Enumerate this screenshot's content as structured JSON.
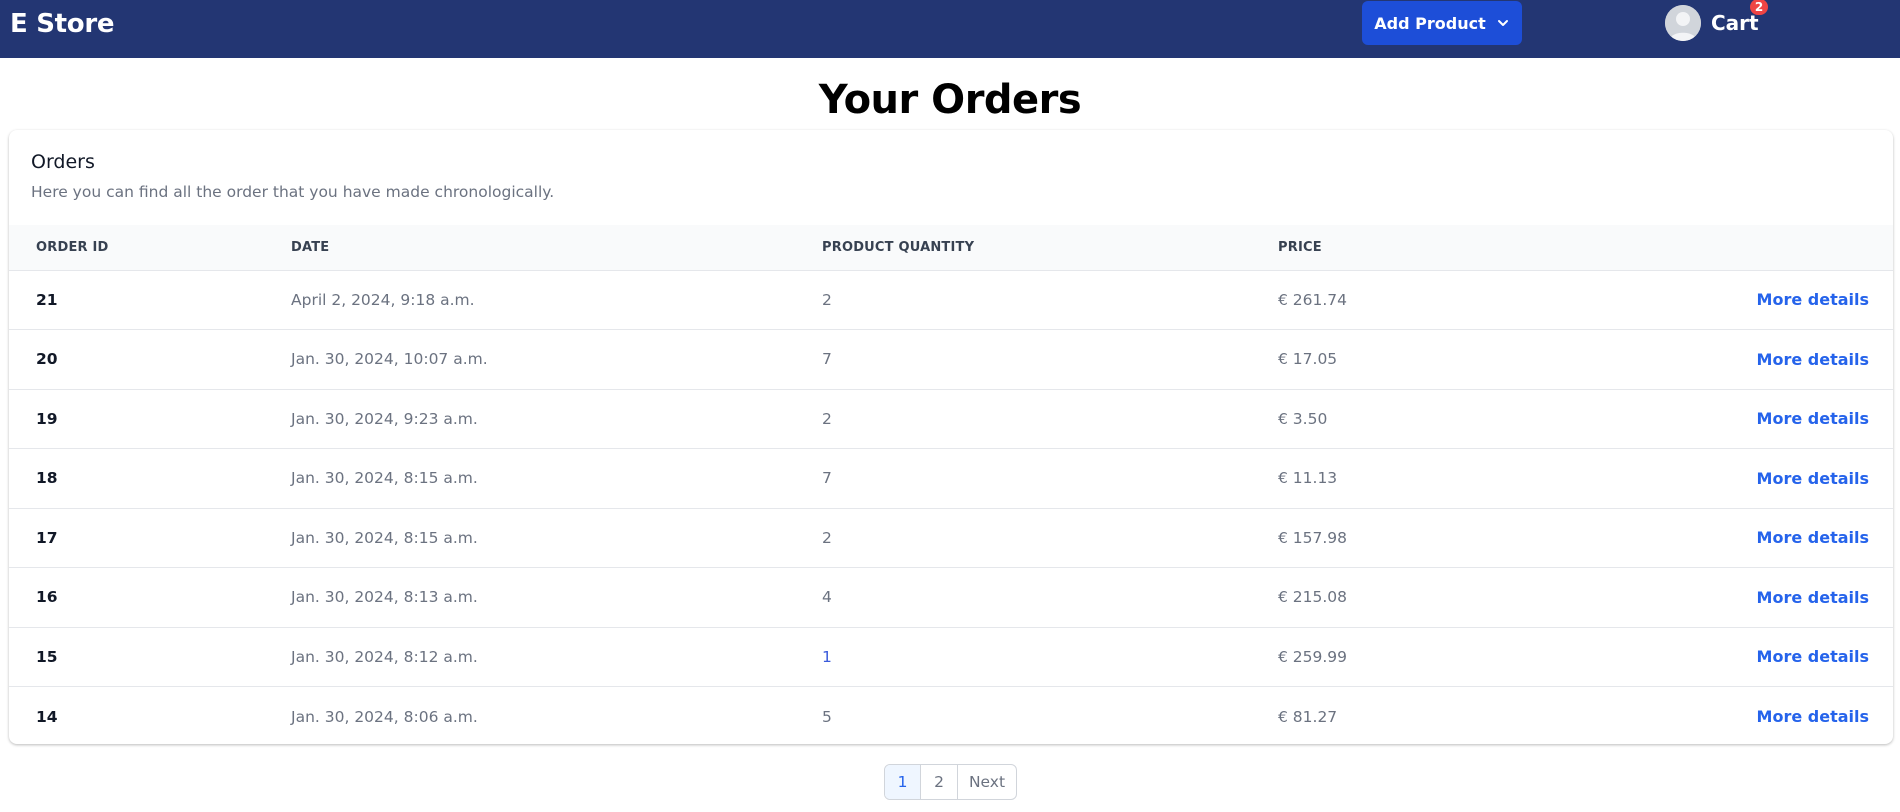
{
  "navbar": {
    "brand": "E Store",
    "add_product_label": "Add Product",
    "cart_label": "Cart",
    "cart_count": "2",
    "colors": {
      "background": "#233673",
      "button": "#1d4ed8",
      "badge": "#ef4444"
    }
  },
  "page": {
    "title": "Your Orders"
  },
  "orders_card": {
    "title": "Orders",
    "description": "Here you can find all the order that you have made chronologically.",
    "columns": [
      "ORDER ID",
      "DATE",
      "PRODUCT QUANTITY",
      "PRICE"
    ],
    "rows": [
      {
        "id": "21",
        "date": "April 2, 2024, 9:18 a.m.",
        "quantity": "2",
        "price": "€ 261.74",
        "action": "More details"
      },
      {
        "id": "20",
        "date": "Jan. 30, 2024, 10:07 a.m.",
        "quantity": "7",
        "price": "€ 17.05",
        "action": "More details"
      },
      {
        "id": "19",
        "date": "Jan. 30, 2024, 9:23 a.m.",
        "quantity": "2",
        "price": "€ 3.50",
        "action": "More details"
      },
      {
        "id": "18",
        "date": "Jan. 30, 2024, 8:15 a.m.",
        "quantity": "7",
        "price": "€ 11.13",
        "action": "More details"
      },
      {
        "id": "17",
        "date": "Jan. 30, 2024, 8:15 a.m.",
        "quantity": "2",
        "price": "€ 157.98",
        "action": "More details"
      },
      {
        "id": "16",
        "date": "Jan. 30, 2024, 8:13 a.m.",
        "quantity": "4",
        "price": "€ 215.08",
        "action": "More details"
      },
      {
        "id": "15",
        "date": "Jan. 30, 2024, 8:12 a.m.",
        "quantity": "1",
        "price": "€ 259.99",
        "action": "More details"
      },
      {
        "id": "14",
        "date": "Jan. 30, 2024, 8:06 a.m.",
        "quantity": "5",
        "price": "€ 81.27",
        "action": "More details"
      }
    ]
  },
  "pagination": {
    "pages": [
      "1",
      "2"
    ],
    "active_page": "1",
    "next_label": "Next"
  }
}
